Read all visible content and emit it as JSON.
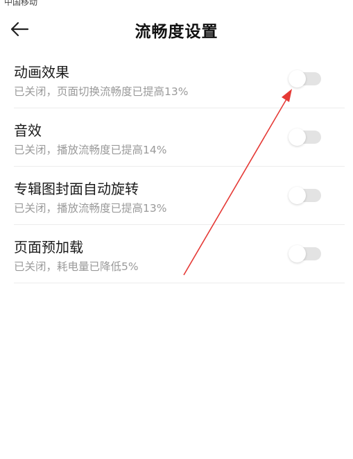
{
  "status_bar": {
    "carrier": "中国移动"
  },
  "header": {
    "back_icon": "arrow-left-icon",
    "title": "流畅度设置"
  },
  "settings": [
    {
      "title": "动画效果",
      "subtitle": "已关闭，页面切换流畅度已提高13%",
      "enabled": false
    },
    {
      "title": "音效",
      "subtitle": "已关闭，播放流畅度已提高14%",
      "enabled": false
    },
    {
      "title": "专辑图封面自动旋转",
      "subtitle": "已关闭，播放流畅度已提高13%",
      "enabled": false
    },
    {
      "title": "页面预加载",
      "subtitle": "已关闭，耗电量已降低5%",
      "enabled": false
    }
  ],
  "annotation": {
    "type": "red-arrow",
    "color": "#e53935"
  },
  "colors": {
    "toggle_off_track": "#e3e3e3",
    "toggle_knob": "#ffffff",
    "subtitle_text": "#9a9a9a"
  }
}
